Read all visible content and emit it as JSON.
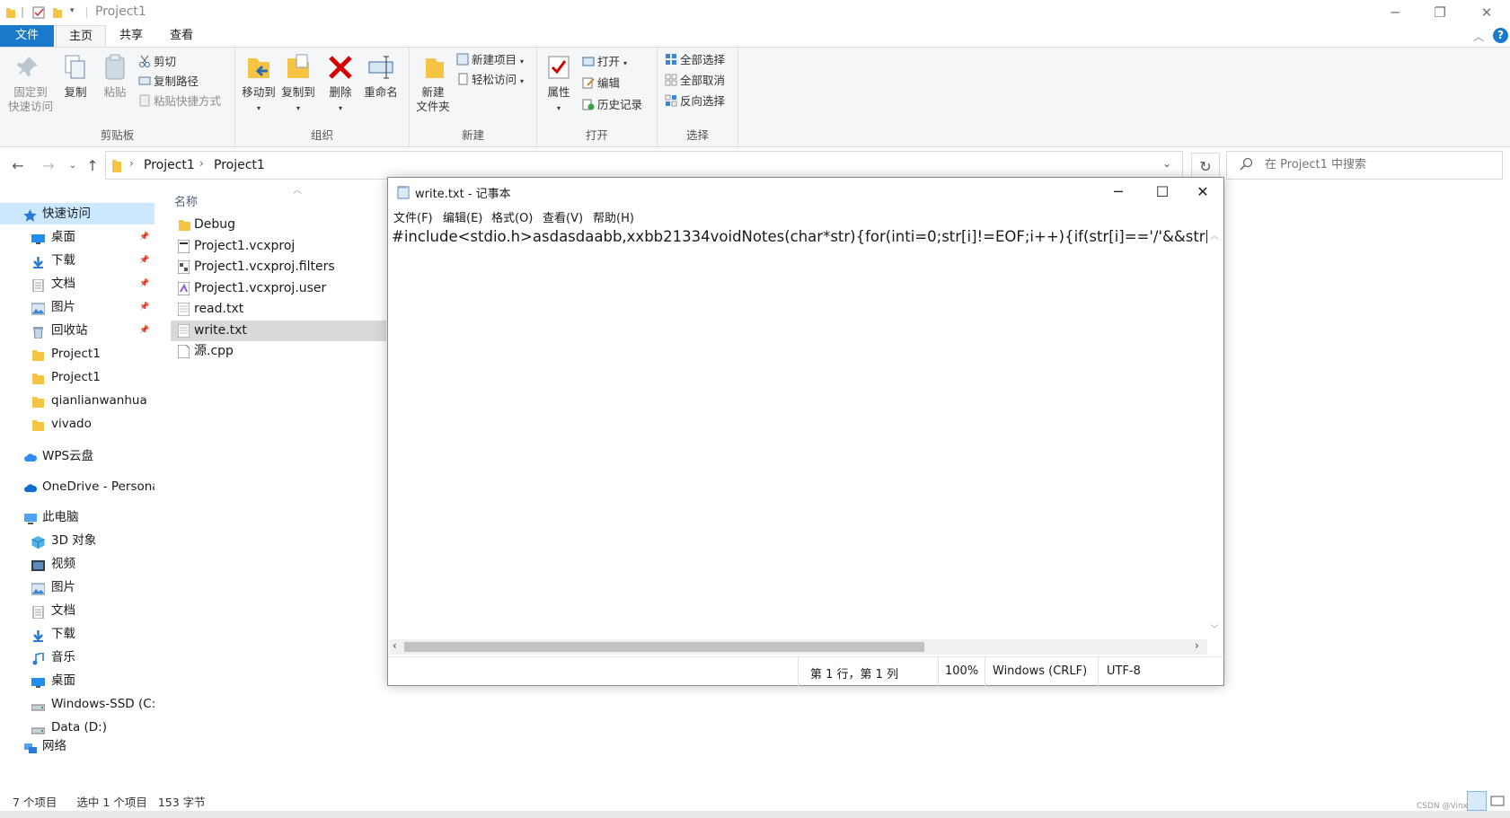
{
  "window": {
    "title": "Project1"
  },
  "ribbon": {
    "tabs": [
      "文件",
      "主页",
      "共享",
      "查看"
    ],
    "clipboard": {
      "group_label": "剪贴板",
      "pin_label": "固定到\n快速访问",
      "copy_label": "复制",
      "paste_label": "粘贴",
      "cut_label": "剪切",
      "copy_path_label": "复制路径",
      "paste_shortcut_label": "粘贴快捷方式"
    },
    "organize": {
      "group_label": "组织",
      "move_to_label": "移动到",
      "copy_to_label": "复制到",
      "delete_label": "删除",
      "rename_label": "重命名"
    },
    "new": {
      "group_label": "新建",
      "new_folder_label": "新建\n文件夹",
      "new_item_label": "新建项目",
      "easy_access_label": "轻松访问"
    },
    "open": {
      "group_label": "打开",
      "properties_label": "属性",
      "open_label": "打开",
      "edit_label": "编辑",
      "history_label": "历史记录"
    },
    "select": {
      "group_label": "选择",
      "select_all_label": "全部选择",
      "select_none_label": "全部取消",
      "invert_label": "反向选择"
    }
  },
  "address": {
    "crumbs": [
      "Project1",
      "Project1"
    ],
    "search_placeholder": "在 Project1 中搜索"
  },
  "nav": {
    "quick_access": "快速访问",
    "quick_items": [
      "桌面",
      "下载",
      "文档",
      "图片",
      "回收站",
      "Project1",
      "Project1",
      "qianlianwanhua",
      "vivado"
    ],
    "wps": "WPS云盘",
    "onedrive": "OneDrive - Persona",
    "this_pc": "此电脑",
    "pc_items": [
      "3D 对象",
      "视频",
      "图片",
      "文档",
      "下载",
      "音乐",
      "桌面",
      "Windows-SSD (C:)",
      "Data (D:)"
    ],
    "network": "网络"
  },
  "files": {
    "column_name": "名称",
    "items": [
      "Debug",
      "Project1.vcxproj",
      "Project1.vcxproj.filters",
      "Project1.vcxproj.user",
      "read.txt",
      "write.txt",
      "源.cpp"
    ]
  },
  "statusbar": {
    "count": "7 个项目",
    "selected": "选中 1 个项目",
    "size": "153 字节"
  },
  "notepad": {
    "title": "write.txt - 记事本",
    "menu": [
      "文件(F)",
      "编辑(E)",
      "格式(O)",
      "查看(V)",
      "帮助(H)"
    ],
    "content": "#include<stdio.h>asdasdaabb,xxbb21334voidNotes(char*str){for(inti=0;str[i]!=EOF;i++){if(str[i]=='/'&&str[i-",
    "status_position": "第 1 行，第 1 列",
    "status_zoom": "100%",
    "status_eol": "Windows (CRLF)",
    "status_encoding": "UTF-8",
    "hscroll_fraction": 0.66
  },
  "watermark": "CSDN @Vinx",
  "colors": {
    "file_tab": "#1979ca",
    "folder": "#f6c443",
    "selection": "#cce8ff",
    "delete_red": "#d40000"
  }
}
